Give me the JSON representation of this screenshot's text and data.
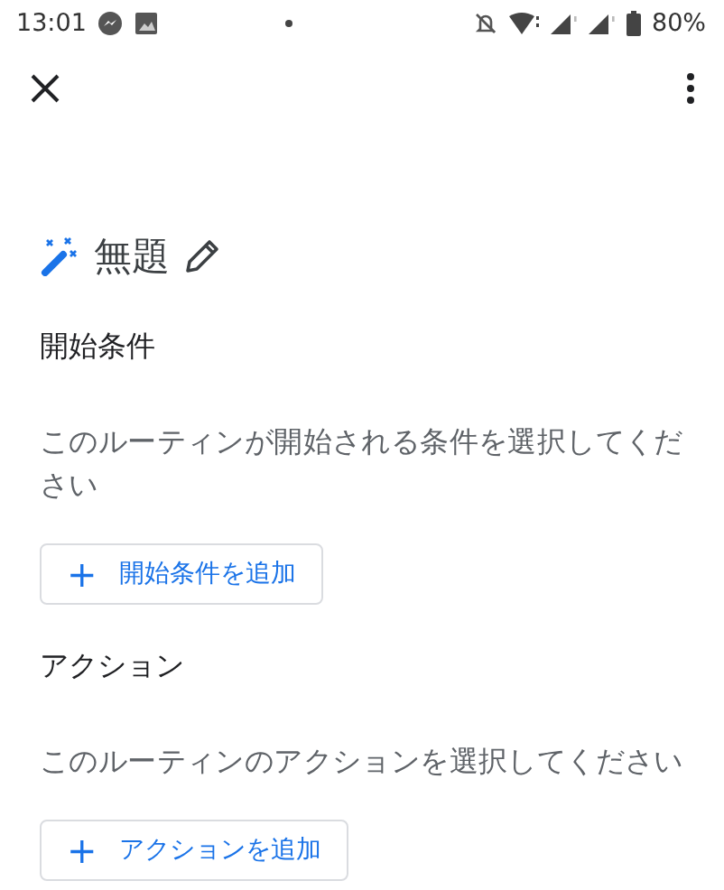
{
  "status_bar": {
    "time": "13:01",
    "battery": "80%"
  },
  "title": "無題",
  "sections": [
    {
      "heading": "開始条件",
      "description": "このルーティンが開始される条件を選択してください",
      "button": {
        "icon": "+",
        "label": "開始条件を追加"
      }
    },
    {
      "heading": "アクション",
      "description": "このルーティンのアクションを選択してください",
      "button": {
        "icon": "+",
        "label": "アクションを追加"
      }
    }
  ]
}
